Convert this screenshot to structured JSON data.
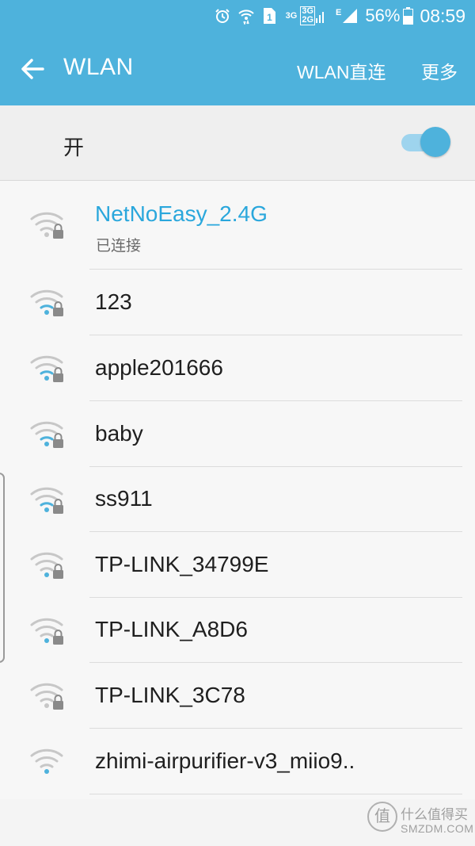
{
  "status_bar": {
    "icons": [
      "alarm-icon",
      "wifi-data-icon",
      "sim-1-icon",
      "dual-signal-3g-2g-icon",
      "edge-signal-icon"
    ],
    "sim_slot": "1",
    "net_3g": "3G",
    "dual_top": "3G",
    "dual_bottom": "2G",
    "edge": "E",
    "battery_percent": "56%",
    "time": "08:59"
  },
  "app_bar": {
    "title": "WLAN",
    "back_icon": "back-arrow-icon",
    "wifi_direct_label": "WLAN直连",
    "more_label": "更多",
    "color": "#4eb2dc"
  },
  "master_switch": {
    "label": "开",
    "state": "on"
  },
  "networks": [
    {
      "ssid": "NetNoEasy_2.4G",
      "status": "已连接",
      "connected": true,
      "secured": true
    },
    {
      "ssid": "123",
      "secured": true
    },
    {
      "ssid": "apple201666",
      "secured": true
    },
    {
      "ssid": "baby",
      "secured": true
    },
    {
      "ssid": "ss911",
      "secured": true
    },
    {
      "ssid": "TP-LINK_34799E",
      "secured": true
    },
    {
      "ssid": "TP-LINK_A8D6",
      "secured": true
    },
    {
      "ssid": "TP-LINK_3C78",
      "secured": true
    },
    {
      "ssid": "zhimi-airpurifier-v3_miio9..",
      "secured": false
    }
  ],
  "watermark": {
    "logo_char": "值",
    "line1": "什么值得买",
    "line2": "SMZDM.COM"
  }
}
